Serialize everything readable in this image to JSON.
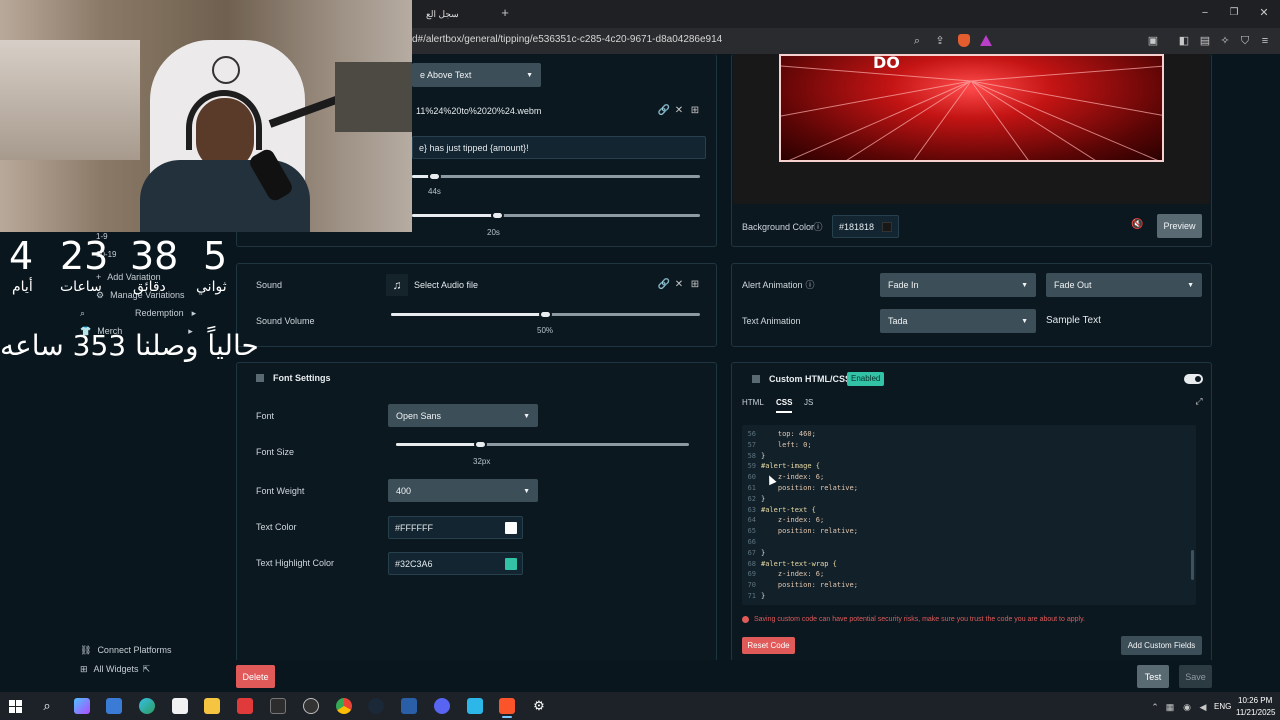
{
  "browser": {
    "tab_title": "سجل الع",
    "new_tab": "+",
    "address": "d#/alertbox/general/tipping/e536351c-c285-4c20-9671-d8a04286e914"
  },
  "media_panel": {
    "layout_value": "e Above Text",
    "file_name": "11%24%20to%2020%24.webm",
    "message_template": "e} has just tipped {amount}!",
    "duration_value": "44s",
    "delay_value": "20s",
    "duration_fraction": 0.08,
    "delay_fraction": 0.3
  },
  "preview_panel": {
    "background_label": "Background Color",
    "background_value": "#181818",
    "preview_button": "Preview"
  },
  "sound_panel": {
    "sound_label": "Sound",
    "sound_file": "Select Audio file",
    "volume_label": "Sound Volume",
    "volume_value": "50%",
    "volume_fraction": 0.5
  },
  "animation_panel": {
    "alert_animation_label": "Alert Animation",
    "alert_in": "Fade In",
    "alert_out": "Fade Out",
    "text_animation_label": "Text Animation",
    "text_animation": "Tada",
    "sample_text": "Sample Text"
  },
  "font_panel": {
    "title": "Font Settings",
    "font_label": "Font",
    "font_value": "Open Sans",
    "size_label": "Font Size",
    "size_value": "32px",
    "size_fraction": 0.29,
    "weight_label": "Font Weight",
    "weight_value": "400",
    "text_color_label": "Text Color",
    "text_color_value": "#FFFFFF",
    "highlight_label": "Text Highlight Color",
    "highlight_value": "#32C3A6"
  },
  "custom_panel": {
    "title": "Custom HTML/CSS",
    "status": "Enabled",
    "tabs": [
      "HTML",
      "CSS",
      "JS"
    ],
    "warning": "Saving custom code can have potential security risks, make sure you trust the code you are about to apply.",
    "reset_button": "Reset Code",
    "add_fields_button": "Add Custom Fields",
    "code_lines": [
      {
        "n": "56",
        "t": "    top: 460;"
      },
      {
        "n": "57",
        "t": "    left: 0;"
      },
      {
        "n": "58",
        "t": "}"
      },
      {
        "n": "59",
        "t": "#alert-image {"
      },
      {
        "n": "60",
        "t": "    z-index: 6;"
      },
      {
        "n": "61",
        "t": "    position: relative;"
      },
      {
        "n": "62",
        "t": "}"
      },
      {
        "n": "63",
        "t": "#alert-text {"
      },
      {
        "n": "64",
        "t": "    z-index: 6;"
      },
      {
        "n": "65",
        "t": "    position: relative;"
      },
      {
        "n": "66",
        "t": ""
      },
      {
        "n": "67",
        "t": "}"
      },
      {
        "n": "68",
        "t": "#alert-text-wrap {"
      },
      {
        "n": "69",
        "t": "    z-index: 6;"
      },
      {
        "n": "70",
        "t": "    position: relative;"
      },
      {
        "n": "71",
        "t": "}"
      }
    ]
  },
  "footer": {
    "delete_button": "Delete",
    "test_button": "Test",
    "save_button": "Save"
  },
  "sidebar": {
    "items": [
      "1-9",
      "10-19",
      "Add Variation",
      "Manage Variations",
      "Redemption",
      "Merch"
    ],
    "connect_platforms": "Connect Platforms",
    "all_widgets": "All Widgets"
  },
  "overlay": {
    "countdown": [
      {
        "num": "4",
        "label": "أيام"
      },
      {
        "num": "23",
        "label": "ساعات"
      },
      {
        "num": "38",
        "label": "دقائق"
      },
      {
        "num": "5",
        "label": "ثواني"
      }
    ],
    "banner_text": "حالياً وصلنا 353 ساعه"
  },
  "taskbar": {
    "time": "10:26 PM",
    "date": "11/21/2025",
    "lang": "ENG"
  },
  "colors": {
    "accent": "#32C3A6",
    "danger": "#e05a5a",
    "panel_bg": "#0b1820"
  }
}
